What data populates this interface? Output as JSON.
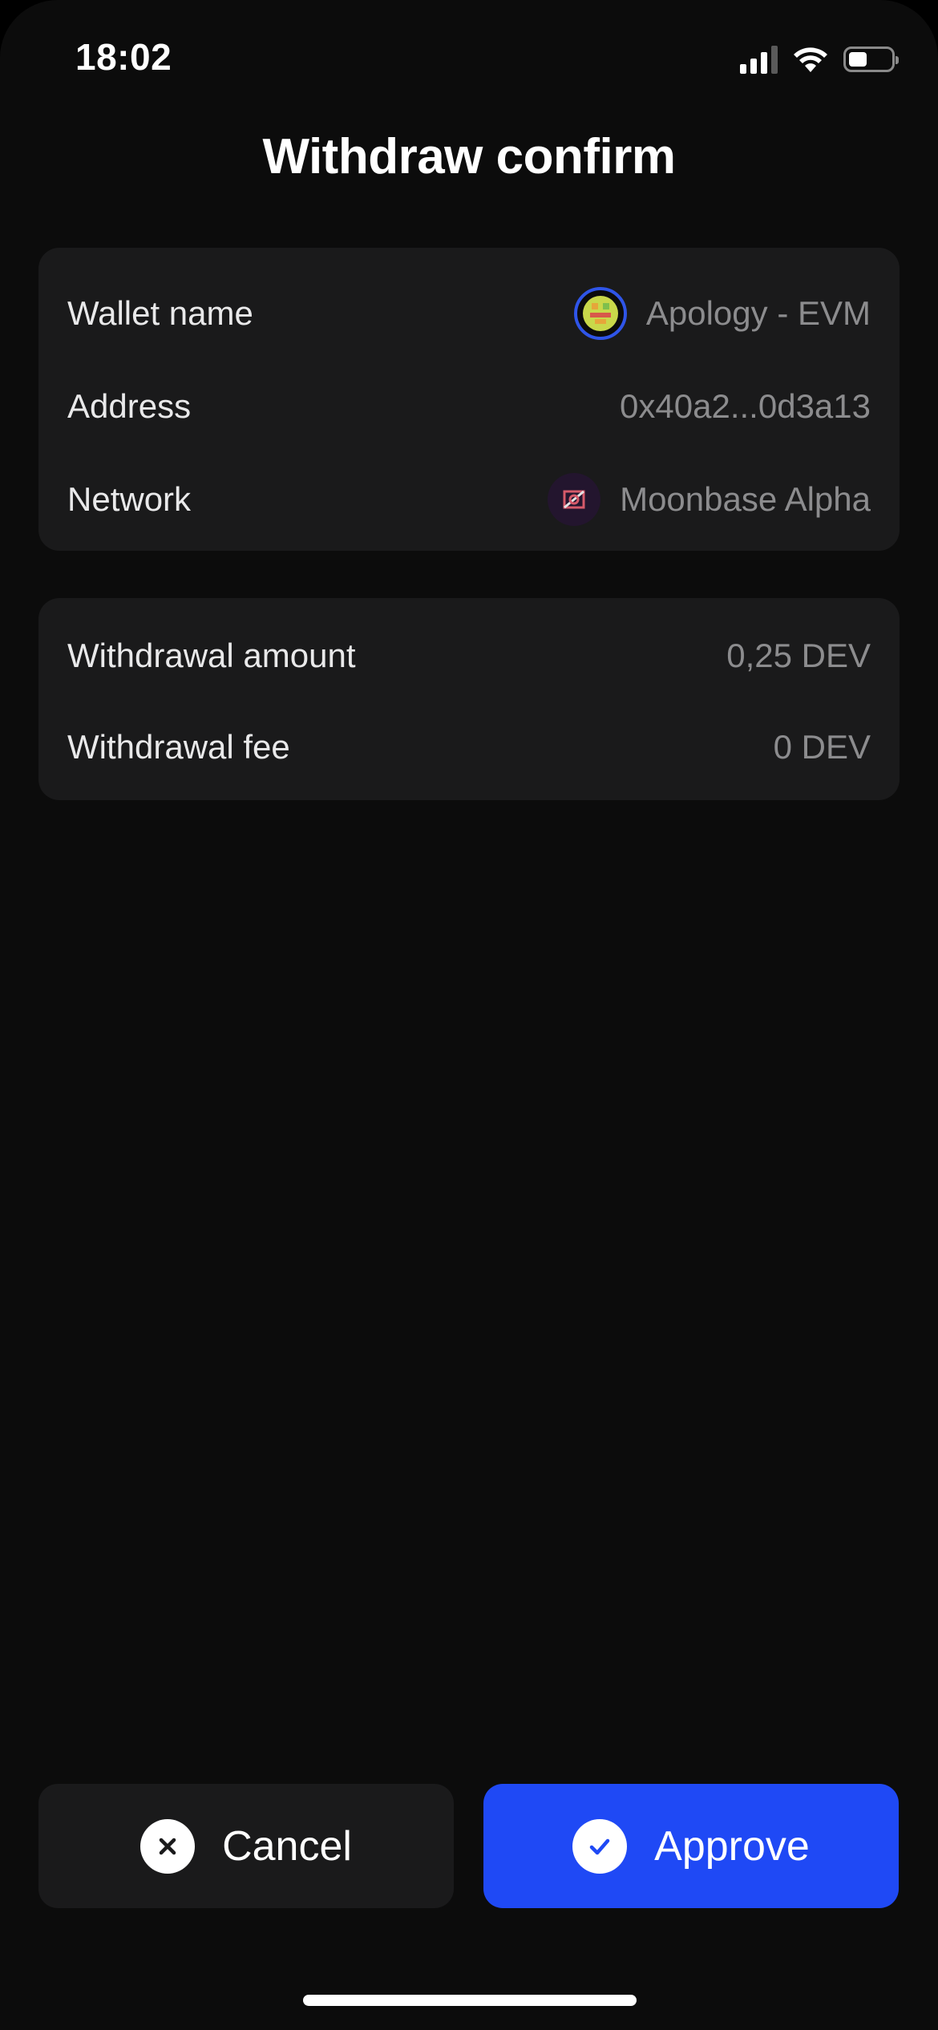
{
  "status_bar": {
    "time": "18:02",
    "icons": [
      "cellular-signal-icon",
      "wifi-icon",
      "battery-icon"
    ],
    "battery_level": 0.45
  },
  "page": {
    "title": "Withdraw confirm"
  },
  "wallet_info": {
    "wallet_name": {
      "label": "Wallet name",
      "value": "Apology - EVM",
      "icon": "wallet-avatar-icon"
    },
    "address": {
      "label": "Address",
      "value": "0x40a2...0d3a13"
    },
    "network": {
      "label": "Network",
      "value": "Moonbase Alpha",
      "icon": "moonbase-alpha-icon"
    }
  },
  "amounts": {
    "withdrawal_amount": {
      "label": "Withdrawal amount",
      "value": "0,25 DEV"
    },
    "withdrawal_fee": {
      "label": "Withdrawal fee",
      "value": "0 DEV"
    }
  },
  "actions": {
    "cancel_label": "Cancel",
    "approve_label": "Approve"
  },
  "colors": {
    "background": "#0c0c0c",
    "card": "#1a1a1b",
    "accent": "#1f49f5",
    "muted_text": "#8c8c8e"
  }
}
